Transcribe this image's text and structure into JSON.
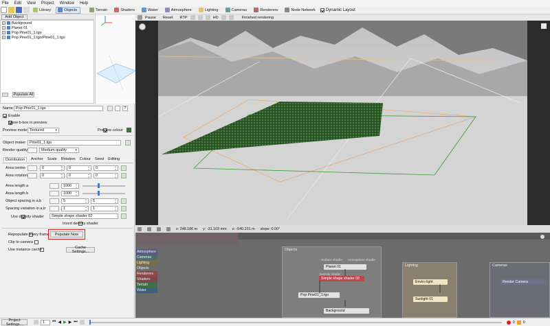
{
  "menu": [
    "File",
    "Edit",
    "View",
    "Project",
    "Window",
    "Help"
  ],
  "toolbar": {
    "tabs": [
      {
        "label": "Library",
        "icon": "library-icon",
        "active": false
      },
      {
        "label": "Objects",
        "icon": "objects-icon",
        "active": true
      },
      {
        "label": "Terrain",
        "icon": "terrain-icon",
        "active": false
      },
      {
        "label": "Shaders",
        "icon": "shaders-icon",
        "active": false
      },
      {
        "label": "Water",
        "icon": "water-icon",
        "active": false
      },
      {
        "label": "Atmosphere",
        "icon": "atmosphere-icon",
        "active": false
      },
      {
        "label": "Lighting",
        "icon": "lighting-icon",
        "active": false
      },
      {
        "label": "Cameras",
        "icon": "cameras-icon",
        "active": false
      },
      {
        "label": "Renderers",
        "icon": "renderers-icon",
        "active": false
      },
      {
        "label": "Node Network",
        "icon": "node-network-icon",
        "active": false
      }
    ],
    "dynamic_layout_label": "Dynamic Layout"
  },
  "scene": {
    "add_object_label": "Add Object",
    "tree": [
      {
        "label": "Background"
      },
      {
        "label": "Planet 01"
      },
      {
        "label": "Pop Pine01_1.tgo"
      },
      {
        "label": "Pop Pine01_1.tgo/Pine01_1.tgo"
      }
    ],
    "populate_all_label": "Populate All"
  },
  "properties": {
    "name_label": "Name",
    "name_value": "Pop Pine01_1.tgo",
    "enable_label": "Enable",
    "show_bbox_label": "Show b-box in preview",
    "preview_mode_label": "Preview mode",
    "preview_mode_value": "Textured",
    "preview_colour_label": "Preview colour",
    "object_maker_label": "Object maker",
    "object_maker_value": "Pine01_1.tgo",
    "render_quality_label": "Render quality",
    "render_quality_value": "Medium quality",
    "subtabs": [
      "Distribution",
      "Anchor",
      "Scale",
      "Rotation",
      "Colour",
      "Seed",
      "Editing"
    ],
    "area_centre_label": "Area centre",
    "area_centre_values": [
      "0",
      "0",
      "0"
    ],
    "area_rotation_label": "Area rotation",
    "area_rotation_values": [
      "0",
      "0",
      "0"
    ],
    "area_length_a_label": "Area length a",
    "area_length_a_value": "1000",
    "area_length_b_label": "Area length b",
    "area_length_b_value": "1000",
    "spacing_label": "Object spacing in a,b",
    "spacing_values": [
      "5",
      "5"
    ],
    "spacing_var_label": "Spacing variation in a,b",
    "spacing_var_values": [
      "1",
      "1"
    ],
    "use_density_label": "Use density shader",
    "density_shader_value": "Simple shape shader 02",
    "invert_density_label": "Invert density shader",
    "repopulate_label": "Repopulate every frame",
    "populate_now_label": "Populate Now",
    "clip_camera_label": "Clip to camera",
    "instance_cache_label": "Use instance cache",
    "cache_settings_label": "Cache Settings..."
  },
  "viewport": {
    "toolbar": [
      "Pause",
      "Reset",
      "RTP",
      "HD",
      "Finished rendering"
    ],
    "status": {
      "x": "x: 248.186 m",
      "y": "y: -31.103 mm",
      "z": "z: -540.231 m",
      "slope": "slope: 0.00°"
    }
  },
  "node_network": {
    "categories": [
      {
        "label": "Atmosphere",
        "color": "#5a5a86"
      },
      {
        "label": "Cameras",
        "color": "#4d6d6d"
      },
      {
        "label": "Lighting",
        "color": "#7a6d4a"
      },
      {
        "label": "Objects",
        "color": "#6b6b6b"
      },
      {
        "label": "Renderers",
        "color": "#8a4a4a"
      },
      {
        "label": "Shaders",
        "color": "#7a4a4a"
      },
      {
        "label": "Terrain",
        "color": "#3f6e4a"
      },
      {
        "label": "Water",
        "color": "#3f5f7a"
      }
    ],
    "objects_group": {
      "title": "Objects",
      "surface_shader_label": "Surface shader",
      "atmosphere_shader_label": "Atmosphere shader",
      "planet_node": "Planet 01",
      "density_shader_label": "Density shader",
      "density_node": "Simple shape shader 02",
      "pop_node": "Pop Pine01_1.tgo",
      "background_node": "Background"
    },
    "lighting_group": {
      "title": "Lighting",
      "nodes": [
        "Enviro light",
        "Sunlight 01"
      ]
    },
    "cameras_group": {
      "title": "Cameras",
      "nodes": [
        "Render Camera"
      ]
    },
    "colors": {
      "density_node": "#c0444a",
      "lighting_node": "#f3e5c0",
      "camera_node": "#6f6f8a"
    }
  },
  "bottom": {
    "project_settings_label": "Project Settings...",
    "frame_value": "1",
    "error_count": "0",
    "warning_count": "0"
  }
}
